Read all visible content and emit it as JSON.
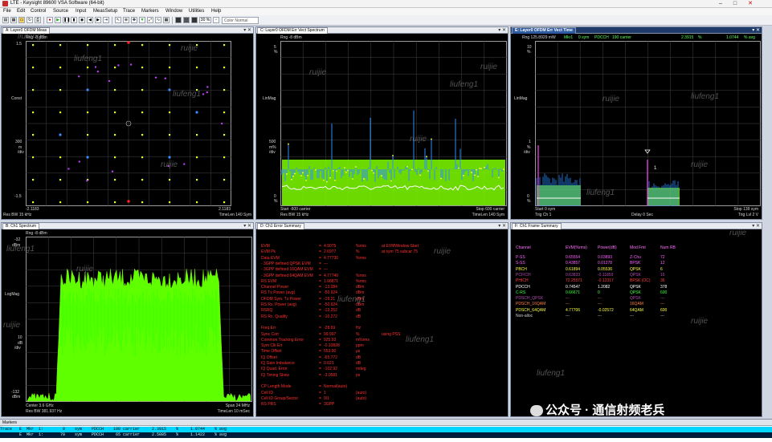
{
  "window": {
    "title": "LTE - Keysight 89600 VSA Software (64-bit)"
  },
  "menu": [
    "File",
    "Edit",
    "Control",
    "Source",
    "Input",
    "MeasSetup",
    "Trace",
    "Markers",
    "Window",
    "Utilities",
    "Help"
  ],
  "toolbar": {
    "zoom": "30 %",
    "color_scheme": "Color Normal"
  },
  "panes": {
    "a": {
      "title": "A: Layer0 OFDM Meas",
      "top_left": "Rng -8 dBm",
      "y_top": "1.5",
      "y_name": "Const",
      "y_mid": "300",
      "y_mid_unit1": "m",
      "y_mid_unit2": "/div",
      "y_bot": "-1.5",
      "x_left": "-2.1183",
      "x_right": "2.1183",
      "foot_left": "Res BW 15 kHz",
      "foot_right": "TimeLen 140  Sym"
    },
    "c": {
      "title": "C: Layer0 OFDM Err Vect Spectrum",
      "top_left": "Rng -8 dBm",
      "y_top": "5",
      "y_top_unit": "%",
      "y_name": "LinMag",
      "y_mid": "500",
      "y_mid_unit1": "m%",
      "y_mid_unit2": "/div",
      "y_bot": "0",
      "y_bot_unit": "%",
      "start": "Start -600  carrier",
      "stop": "Stop 600  carrier",
      "foot_left": "Res BW 15 kHz",
      "foot_right": "TimeLen 140  Sym"
    },
    "e": {
      "title": "E: Layer0 OFDM Err Vect Time",
      "header": "Rng 125.8929 mW",
      "header_parts": [
        "Mkr1",
        "0  sym",
        "PDCCH",
        "190 carrier",
        "2.3915",
        "%",
        "1.0744",
        "% avg"
      ],
      "y_top": "10",
      "y_top_unit": "%",
      "y_name": "LinMag",
      "y_mid": "1",
      "y_mid_unit1": "%",
      "y_mid_unit2": "/div",
      "y_bot": "0",
      "y_bot_unit": "%",
      "start": "Start 0  sym",
      "stop": "Stop 139  sym",
      "foot_left": "Trig Ch 1",
      "foot_mid": "Delay 0  Sec",
      "foot_right": "Trig Lvl 2  V",
      "marker_label": "1"
    },
    "b": {
      "title": "B: Ch1 Spectrum",
      "top_left": "Rng -8 dBm",
      "y_top": "-32",
      "y_top_unit": "dBm",
      "y_name": "LogMag",
      "y_mid": "10",
      "y_mid_unit1": "dB",
      "y_mid_unit2": "/div",
      "y_bot": "-132",
      "y_bot_unit": "dBm",
      "center": "Center 3.6 GHz",
      "span": "Span 24 MHz",
      "foot_left": "Res BW 381.937  Hz",
      "foot_right": "TimeLen 10 mSec"
    },
    "d": {
      "title": "D: Ch1 Error Summary",
      "rows": [
        {
          "name": "EVM",
          "val": "4.9075",
          "unit": "%rms",
          "extra": "at  EVMWindow Start"
        },
        {
          "name": "EVM Pk",
          "val": "2.6977",
          "unit": "%",
          "extra": "at  sym 75  subcar 75"
        },
        {
          "name": "Data EVM",
          "val": "4.77736",
          "unit": "%rms",
          "extra": ""
        },
        {
          "name": "- 3GPP defined QPSK EVM",
          "val": "---",
          "unit": "",
          "extra": ""
        },
        {
          "name": "- 3GPP defined 16QAM EVM",
          "val": "---",
          "unit": "",
          "extra": ""
        },
        {
          "name": "- 3GPP defined 64QAM EVM",
          "val": "4.77740",
          "unit": "%rms",
          "extra": ""
        },
        {
          "name": "RS EVM",
          "val": "1.08871",
          "unit": "%rms",
          "extra": ""
        },
        {
          "name": "Channel Power",
          "val": "-13.084",
          "unit": "dBm",
          "extra": ""
        },
        {
          "name": "RS Tx Power (avg)",
          "val": "-50.924",
          "unit": "dBm",
          "extra": ""
        },
        {
          "name": "OFDM Sym. Tx Power",
          "val": "-19.21",
          "unit": "dBm",
          "extra": ""
        },
        {
          "name": "RS Rx. Power (avg)",
          "val": "-50.924",
          "unit": "dBm",
          "extra": ""
        },
        {
          "name": "RSRQ",
          "val": "-13.252",
          "unit": "dB",
          "extra": ""
        },
        {
          "name": "RS Rx. Quality",
          "val": "-10.272",
          "unit": "dB",
          "extra": ""
        },
        {
          "name": "",
          "val": "",
          "unit": "",
          "extra": ""
        },
        {
          "name": "Freq Err",
          "val": "-28.69",
          "unit": "Hz",
          "extra": ""
        },
        {
          "name": "Sync Corr",
          "val": "99.997",
          "unit": "%",
          "extra": "using  PSS"
        },
        {
          "name": "Common Tracking Error",
          "val": "925.93",
          "unit": "m%rms",
          "extra": ""
        },
        {
          "name": "Sym Clk Err",
          "val": "-0.10828",
          "unit": "ppm",
          "extra": ""
        },
        {
          "name": "Time Offset",
          "val": "553.90",
          "unit": "µs",
          "extra": ""
        },
        {
          "name": "IQ Offset",
          "val": "-65.772",
          "unit": "dB",
          "extra": ""
        },
        {
          "name": "IQ Gain Imbalance",
          "val": "0.021",
          "unit": "dB",
          "extra": ""
        },
        {
          "name": "IQ Quad. Error",
          "val": "-102.92",
          "unit": "mdeg",
          "extra": ""
        },
        {
          "name": "IQ Timing Skew",
          "val": "-3.0581",
          "unit": "ps",
          "extra": ""
        },
        {
          "name": "",
          "val": "",
          "unit": "",
          "extra": ""
        },
        {
          "name": "CP Length Mode",
          "val": "Normal(auto)",
          "unit": "",
          "extra": ""
        },
        {
          "name": "Cell ID",
          "val": "1",
          "unit": "(auto)",
          "extra": ""
        },
        {
          "name": "Cell ID Group/Sector",
          "val": "0/1",
          "unit": "(auto)",
          "extra": ""
        },
        {
          "name": "RS PRS",
          "val": "3GPP",
          "unit": "",
          "extra": ""
        }
      ]
    },
    "f": {
      "title": "F: Ch1 Frame Summary",
      "headers": [
        "Channel",
        "EVM(%rms)",
        "Power(dB)",
        "Mod Fmt",
        "Num RB"
      ],
      "rows": [
        {
          "c": "P-SS",
          "e": "0.65554",
          "p": "0.03893",
          "m": "Z-Chu",
          "r": "72",
          "color": "#ff5fff"
        },
        {
          "c": "S-SS",
          "e": "0.43857",
          "p": "0.01278",
          "m": "BPSK",
          "r": "12",
          "color": "#ff5fff"
        },
        {
          "c": "PBCH",
          "e": "0.61894",
          "p": "0.05536",
          "m": "QPSK",
          "r": "6",
          "color": "#ffff40"
        },
        {
          "c": "PCFICH",
          "e": "0.63833",
          "p": "-0.11859",
          "m": "QPSK",
          "r": "16",
          "color": "#b04ab0"
        },
        {
          "c": "PHICH",
          "e": "72.25571",
          "p": "-0.12317",
          "m": "BPSK (OC)",
          "r": "36",
          "color": "#ff4040"
        },
        {
          "c": "PDCCH",
          "e": "0.74547",
          "p": "1.2082",
          "m": "QPSK",
          "r": "378",
          "color": "#ffffff"
        },
        {
          "c": "C-RS",
          "e": "0.66671",
          "p": "0",
          "m": "QPSK",
          "r": "600",
          "color": "#40ff40"
        },
        {
          "c": "PDSCH_QPSK",
          "e": "---",
          "p": "---",
          "m": "QPSK",
          "r": "---",
          "color": "#b04ab0"
        },
        {
          "c": "PDSCH_16QAM",
          "e": "---",
          "p": "---",
          "m": "16QAM",
          "r": "---",
          "color": "#ff8040"
        },
        {
          "c": "PDSCH_64QAM",
          "e": "4.77706",
          "p": "-0.02572",
          "m": "64QAM",
          "r": "600",
          "color": "#ffff40"
        },
        {
          "c": "Non-alloc",
          "e": "---",
          "p": "---",
          "m": "---",
          "r": "---",
          "color": "#d0d0d0"
        }
      ]
    }
  },
  "markers": {
    "title": "Markers",
    "row1": "Trace   E  Mkr  1:        0    sym    PDCCH    190 carrier     2.3915    %     1.0744    % avg",
    "row2": "        E  Mkr  1:       70    sym    PDCCH     65 carrier     2.5085    %     1.1422    % avg"
  },
  "watermarks": [
    "liufeng1",
    "ruijie",
    "liufeng1",
    "ruijie",
    "liufeng1",
    "ruijie",
    "liufeng1",
    "ruijie",
    "liufeng1",
    "ruijie",
    "liufeng1",
    "ruijie",
    "liufeng1",
    "ruijie",
    "liufeng1",
    "ruijie",
    "liufeng1",
    "ruijie",
    "liufeng1",
    "ruijie",
    "ruijie",
    "ruijie"
  ],
  "wechat": "公众号 · 通信射频老兵",
  "colors": {
    "trace_green": "#6fff00",
    "trace_blue": "#2a8cff",
    "err_red": "#ff2020",
    "frame_yellow": "#ffff40"
  }
}
